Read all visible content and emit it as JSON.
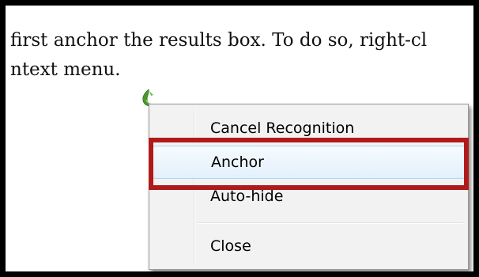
{
  "document": {
    "line1": "first anchor the results box. To do so, right-cl",
    "line2": "ntext menu."
  },
  "icon": {
    "name": "ink-recognition-icon",
    "color": "#4a9a2e"
  },
  "context_menu": {
    "items": [
      {
        "label": "Cancel Recognition"
      },
      {
        "label": "Anchor",
        "highlighted": true
      },
      {
        "label": "Auto-hide"
      },
      {
        "label": "Close"
      }
    ]
  },
  "colors": {
    "highlight_border": "#b11a1a",
    "hover_fill": "#e3f0fb",
    "hover_border": "#a8d8f0",
    "menu_background": "#f2f2f2"
  }
}
